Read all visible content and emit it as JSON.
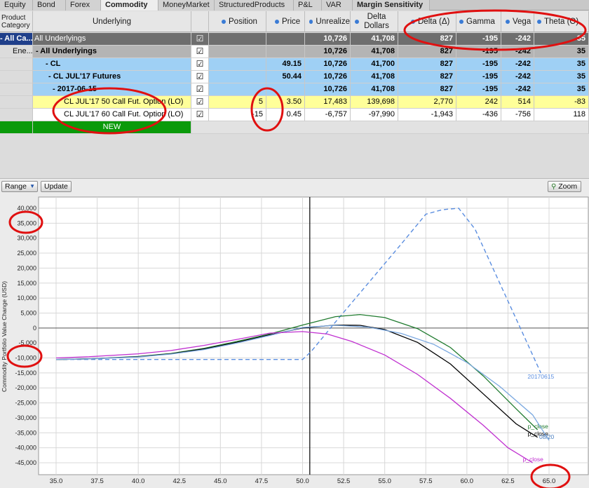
{
  "tabs": [
    "Equity",
    "Bond",
    "Forex",
    "Commodity",
    "MoneyMarket",
    "StructuredProducts",
    "P&L",
    "VAR",
    "Margin Sensitivity"
  ],
  "active_tab": "Commodity",
  "columns": {
    "product": "Product Category",
    "underlying": "Underlying",
    "position": "Position",
    "price": "Price",
    "unrealized": "Unrealize",
    "delta_dollars": "Delta Dollars",
    "delta": "Delta (Δ)",
    "gamma": "Gamma",
    "vega": "Vega",
    "theta": "Theta (Θ)"
  },
  "rows": [
    {
      "product": "- All Ca...",
      "underlying": "All Underlyings",
      "position": "",
      "price": "",
      "unrealized": "10,726",
      "delta_dollars": "41,708",
      "delta": "827",
      "gamma": "-195",
      "vega": "-242",
      "theta": "35"
    },
    {
      "product": "Ene...",
      "underlying": "- All Underlyings",
      "position": "",
      "price": "",
      "unrealized": "10,726",
      "delta_dollars": "41,708",
      "delta": "827",
      "gamma": "-195",
      "vega": "-242",
      "theta": "35"
    },
    {
      "product": "",
      "underlying": "- CL",
      "position": "",
      "price": "49.15",
      "unrealized": "10,726",
      "delta_dollars": "41,700",
      "delta": "827",
      "gamma": "-195",
      "vega": "-242",
      "theta": "35"
    },
    {
      "product": "",
      "underlying": "- CL JUL'17 Futures",
      "position": "",
      "price": "50.44",
      "unrealized": "10,726",
      "delta_dollars": "41,708",
      "delta": "827",
      "gamma": "-195",
      "vega": "-242",
      "theta": "35"
    },
    {
      "product": "",
      "underlying": "- 2017-06-15",
      "position": "",
      "price": "",
      "unrealized": "10,726",
      "delta_dollars": "41,708",
      "delta": "827",
      "gamma": "-195",
      "vega": "-242",
      "theta": "35"
    },
    {
      "product": "",
      "underlying": "CL JUL'17 50 Call Fut. Option (LO)",
      "position": "5",
      "price": "3.50",
      "unrealized": "17,483",
      "delta_dollars": "139,698",
      "delta": "2,770",
      "gamma": "242",
      "vega": "514",
      "theta": "-83"
    },
    {
      "product": "",
      "underlying": "CL JUL'17 60 Call Fut. Option (LO)",
      "position": "-15",
      "price": "0.45",
      "unrealized": "-6,757",
      "delta_dollars": "-97,990",
      "delta": "-1,943",
      "gamma": "-436",
      "vega": "-756",
      "theta": "118"
    }
  ],
  "new_row_label": "NEW",
  "toolbar": {
    "range_label": "Range",
    "update_label": "Update",
    "zoom_label": "Zoom"
  },
  "chart_data": {
    "type": "line",
    "ylabel": "Commodity Portfolio Value Change (USD)",
    "xlim": [
      35.0,
      65.0
    ],
    "ylim": [
      -45000,
      40000
    ],
    "x_ticks": [
      "35.0",
      "37.5",
      "40.0",
      "42.5",
      "45.0",
      "47.5",
      "50.0",
      "52.5",
      "55.0",
      "57.5",
      "60.0",
      "62.5",
      "65.0"
    ],
    "y_ticks": [
      "40,000",
      "35,000",
      "30,000",
      "25,000",
      "20,000",
      "15,000",
      "10,000",
      "5,000",
      "0",
      "-5,000",
      "-10,000",
      "-15,000",
      "-20,000",
      "-25,000",
      "-30,000",
      "-35,000",
      "-40,000",
      "-45,000"
    ],
    "current_price_x": 50.44,
    "series": [
      {
        "name": "20170615",
        "color": "#5b8ee0",
        "dashed": true,
        "x": [
          35,
          38,
          42,
          46,
          50,
          50.5,
          52,
          54,
          56,
          57.5,
          58.5,
          59.5,
          60.5,
          62,
          63.5,
          64.5
        ],
        "y": [
          -10500,
          -10500,
          -10500,
          -10500,
          -10500,
          -8000,
          2000,
          15000,
          28000,
          38000,
          39500,
          40000,
          33000,
          15000,
          -3000,
          -15000
        ]
      },
      {
        "name": "p_close",
        "color": "#1f7a2e",
        "dashed": false,
        "x": [
          35,
          37,
          40,
          42,
          44,
          46,
          48,
          50,
          52,
          53.5,
          55,
          57,
          59,
          61,
          63,
          64.3
        ],
        "y": [
          -10500,
          -10300,
          -9500,
          -8500,
          -6800,
          -4500,
          -2000,
          1000,
          3800,
          4500,
          3500,
          -200,
          -6500,
          -16000,
          -27000,
          -34000
        ]
      },
      {
        "name": "p_close",
        "color": "#000000",
        "dashed": false,
        "x": [
          35,
          37,
          40,
          42,
          44,
          46,
          48,
          50,
          52,
          53.5,
          55,
          57,
          59,
          61,
          63,
          64.3
        ],
        "y": [
          -10500,
          -10300,
          -9600,
          -8600,
          -7000,
          -4800,
          -2300,
          0,
          1000,
          900,
          -500,
          -4800,
          -12000,
          -22000,
          -32000,
          -36500
        ]
      },
      {
        "name": "08/20",
        "color": "#7aa8e0",
        "dashed": false,
        "x": [
          35,
          37,
          40,
          42,
          44,
          46,
          48,
          50,
          52,
          54,
          56,
          58,
          60,
          62,
          64,
          65
        ],
        "y": [
          -10500,
          -10300,
          -9700,
          -8700,
          -7200,
          -5000,
          -2500,
          200,
          900,
          300,
          -1800,
          -5500,
          -11500,
          -19500,
          -29000,
          -37500
        ]
      },
      {
        "name": "p_close",
        "color": "#c030d0",
        "dashed": false,
        "x": [
          35,
          37,
          40,
          42,
          44,
          46,
          48,
          50,
          51.5,
          53,
          55,
          57,
          59,
          61,
          62.5,
          64
        ],
        "y": [
          -10000,
          -9600,
          -8600,
          -7500,
          -5800,
          -3800,
          -1700,
          -1200,
          -2000,
          -4500,
          -9000,
          -15500,
          -23500,
          -32500,
          -40000,
          -45000
        ]
      }
    ]
  }
}
